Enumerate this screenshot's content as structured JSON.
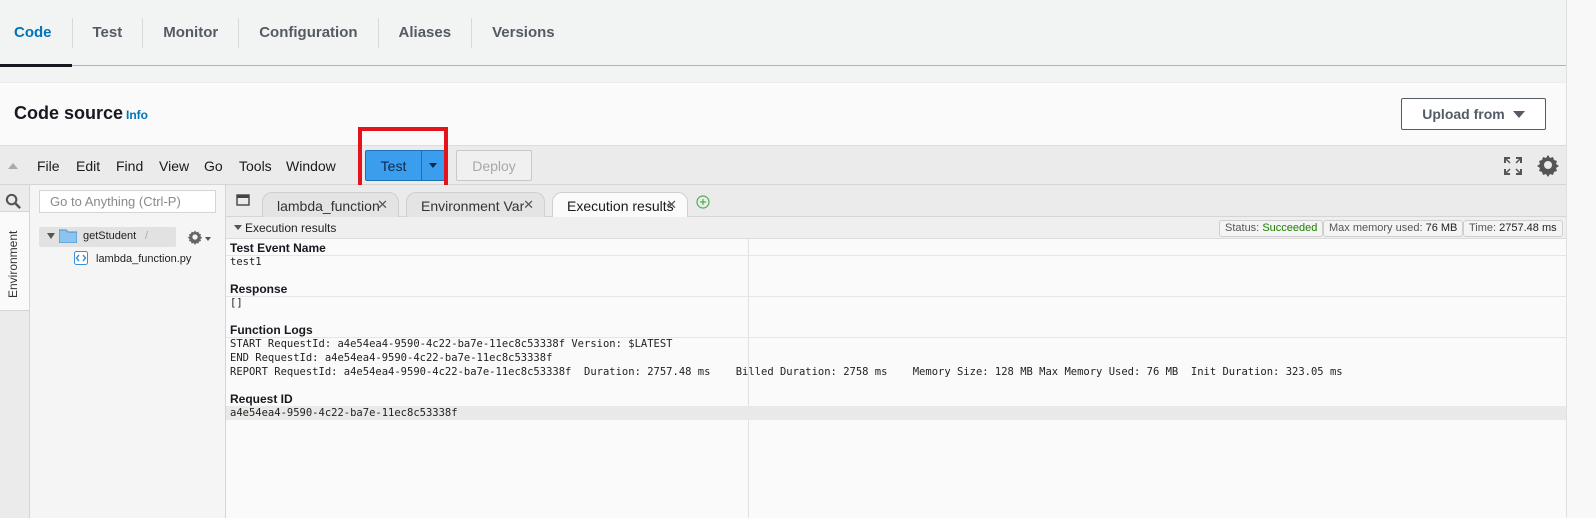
{
  "tabs": [
    {
      "label": "Code",
      "active": true
    },
    {
      "label": "Test",
      "active": false
    },
    {
      "label": "Monitor",
      "active": false
    },
    {
      "label": "Configuration",
      "active": false
    },
    {
      "label": "Aliases",
      "active": false
    },
    {
      "label": "Versions",
      "active": false
    }
  ],
  "code_source": {
    "title": "Code source",
    "info_link": "Info",
    "upload_button": "Upload from"
  },
  "menubar": {
    "items": [
      "File",
      "Edit",
      "Find",
      "View",
      "Go",
      "Tools",
      "Window"
    ],
    "test_button": "Test",
    "deploy_button": "Deploy"
  },
  "sidebar": {
    "environment_label": "Environment",
    "goto_placeholder": "Go to Anything (Ctrl-P)",
    "folder_name": "getStudent",
    "folder_suffix": "/",
    "file_name": "lambda_function.py"
  },
  "editor_tabs": [
    {
      "label": "lambda_function",
      "active": false
    },
    {
      "label": "Environment Var",
      "active": false
    },
    {
      "label": "Execution results",
      "active": true
    }
  ],
  "results": {
    "header": "Execution results",
    "status_label": "Status:",
    "status_value": "Succeeded",
    "memory_label": "Max memory used:",
    "memory_value": "76 MB",
    "time_label": "Time:",
    "time_value": "2757.48 ms",
    "test_event_title": "Test Event Name",
    "test_event_value": "test1",
    "response_title": "Response",
    "response_value": "[]",
    "logs_title": "Function Logs",
    "log_lines": [
      "START RequestId: a4e54ea4-9590-4c22-ba7e-11ec8c53338f Version: $LATEST",
      "END RequestId: a4e54ea4-9590-4c22-ba7e-11ec8c53338f",
      "REPORT RequestId: a4e54ea4-9590-4c22-ba7e-11ec8c53338f  Duration: 2757.48 ms    Billed Duration: 2758 ms    Memory Size: 128 MB Max Memory Used: 76 MB  Init Duration: 323.05 ms"
    ],
    "request_id_title": "Request ID",
    "request_id_value": "a4e54ea4-9590-4c22-ba7e-11ec8c53338f"
  },
  "colors": {
    "active_tab": "#0073bb",
    "test_button": "#3b9dee",
    "highlight_box": "#e3141b",
    "status_success": "#1d8102"
  }
}
